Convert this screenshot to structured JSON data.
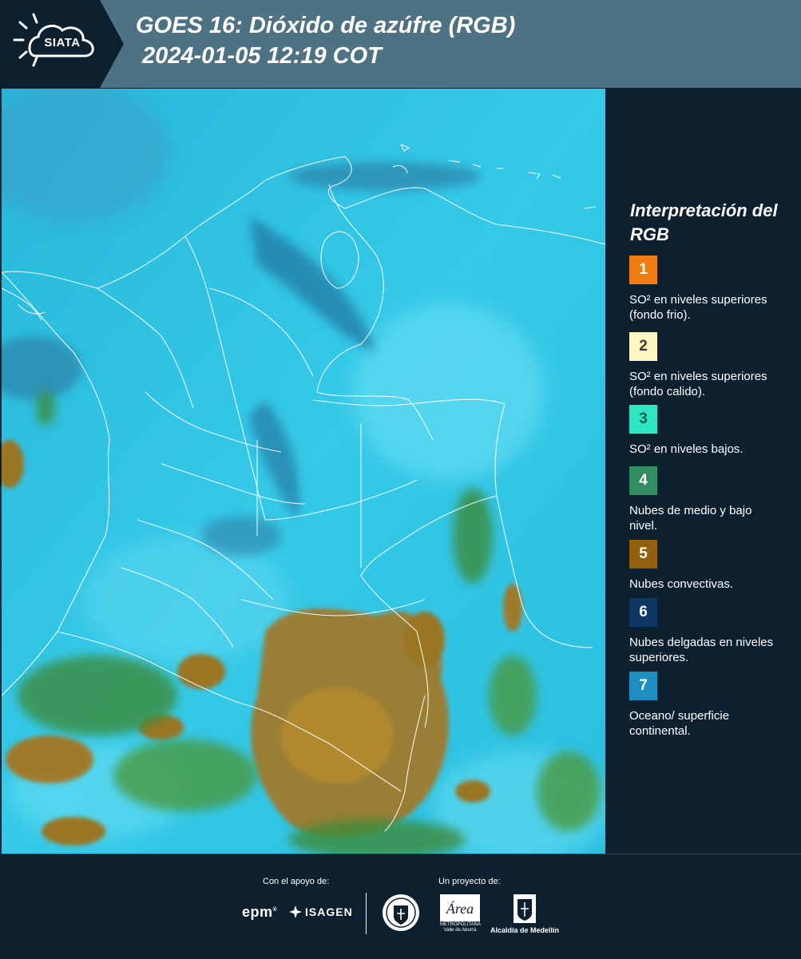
{
  "header": {
    "logo_text": "SIATA",
    "title_line1": "GOES 16: Dióxido de azúfre (RGB)",
    "title_line2": "2024-01-05 12:19 COT"
  },
  "legend": {
    "title": "Interpretación del RGB",
    "items": [
      {
        "number": "1",
        "label": "SO² en niveles superiores (fondo frio).",
        "color": "#f07d12",
        "text_color": "#ffffff"
      },
      {
        "number": "2",
        "label": "SO² en niveles superiores (fondo calido).",
        "color": "#fff6c3",
        "text_color": "#3a3a3a"
      },
      {
        "number": "3",
        "label": "SO² en niveles bajos.",
        "color": "#2fe6c4",
        "text_color": "#1d5a4e"
      },
      {
        "number": "4",
        "label": "Nubes de medio y bajo nivel.",
        "color": "#2f8d5e",
        "text_color": "#ffffff"
      },
      {
        "number": "5",
        "label": "Nubes convectivas.",
        "color": "#93610e",
        "text_color": "#ffffff"
      },
      {
        "number": "6",
        "label": "Nubes delgadas en niveles superiores.",
        "color": "#0f3766",
        "text_color": "#ffffff"
      },
      {
        "number": "7",
        "label": "Oceano/ superficie continental.",
        "color": "#1e8fc2",
        "text_color": "#ffffff"
      }
    ]
  },
  "footer": {
    "support_label": "Con el apoyo de:",
    "project_label": "Un proyecto de:",
    "epm": "epm",
    "isagen": "ISAGEN",
    "area_logo_text": "Área",
    "area_sub_text": "METROPOLITANA Valle de Aburrá",
    "alcaldia": "Alcaldía de Medellín"
  },
  "colors": {
    "header_bg": "#4d7283",
    "panel_bg": "#0c2030",
    "map_cyan": "#2cc8e8",
    "map_brown": "#a07a2a",
    "map_green": "#3c8c3a"
  }
}
